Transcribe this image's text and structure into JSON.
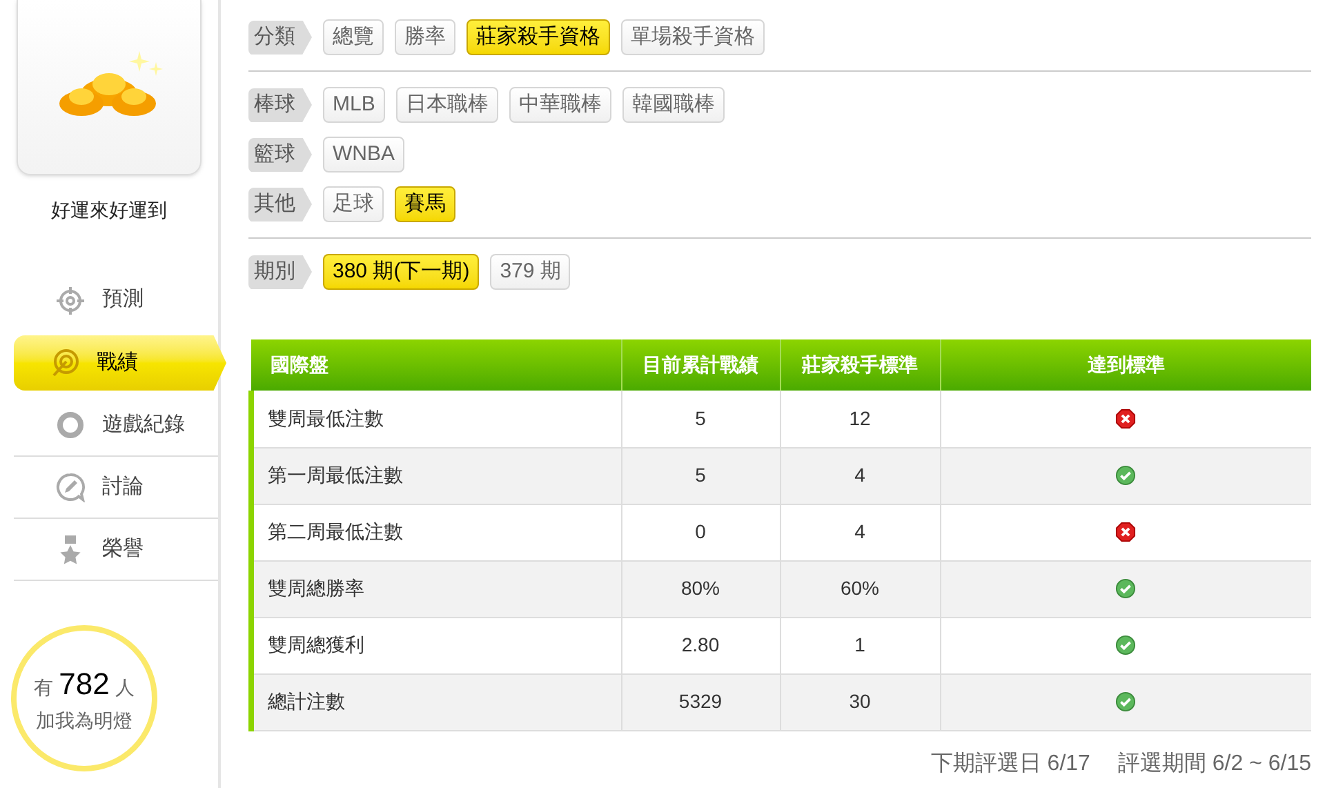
{
  "profile": {
    "name": "好運來好運到"
  },
  "nav": [
    {
      "label": "預測",
      "selected": false
    },
    {
      "label": "戰績",
      "selected": true
    },
    {
      "label": "遊戲紀錄",
      "selected": false
    },
    {
      "label": "討論",
      "selected": false
    },
    {
      "label": "榮譽",
      "selected": false
    }
  ],
  "fans": {
    "prefix": "有",
    "count": "782",
    "suffix": "人",
    "caption": "加我為明燈"
  },
  "filter_sections": [
    {
      "rows": [
        {
          "label": "分類",
          "options": [
            {
              "label": "總覽",
              "selected": false
            },
            {
              "label": "勝率",
              "selected": false
            },
            {
              "label": "莊家殺手資格",
              "selected": true
            },
            {
              "label": "單場殺手資格",
              "selected": false
            }
          ]
        }
      ]
    },
    {
      "rows": [
        {
          "label": "棒球",
          "options": [
            {
              "label": "MLB",
              "selected": false
            },
            {
              "label": "日本職棒",
              "selected": false
            },
            {
              "label": "中華職棒",
              "selected": false
            },
            {
              "label": "韓國職棒",
              "selected": false
            }
          ]
        },
        {
          "label": "籃球",
          "options": [
            {
              "label": "WNBA",
              "selected": false
            }
          ]
        },
        {
          "label": "其他",
          "options": [
            {
              "label": "足球",
              "selected": false
            },
            {
              "label": "賽馬",
              "selected": true
            }
          ]
        }
      ]
    },
    {
      "rows": [
        {
          "label": "期別",
          "options": [
            {
              "label": "380 期(下一期)",
              "selected": true
            },
            {
              "label": "379 期",
              "selected": false
            }
          ]
        }
      ]
    }
  ],
  "table": {
    "columns": [
      "國際盤",
      "目前累計戰績",
      "莊家殺手標準",
      "達到標準"
    ],
    "rows": [
      {
        "cells": [
          "雙周最低注數",
          "5",
          "12"
        ],
        "met": false
      },
      {
        "cells": [
          "第一周最低注數",
          "5",
          "4"
        ],
        "met": true
      },
      {
        "cells": [
          "第二周最低注數",
          "0",
          "4"
        ],
        "met": false
      },
      {
        "cells": [
          "雙周總勝率",
          "80%",
          "60%"
        ],
        "met": true
      },
      {
        "cells": [
          "雙周總獲利",
          "2.80",
          "1"
        ],
        "met": true
      },
      {
        "cells": [
          "總計注數",
          "5329",
          "30"
        ],
        "met": true
      }
    ]
  },
  "footer": {
    "next_date": "下期評選日 6/17",
    "period": "評選期間 6/2 ~ 6/15"
  }
}
